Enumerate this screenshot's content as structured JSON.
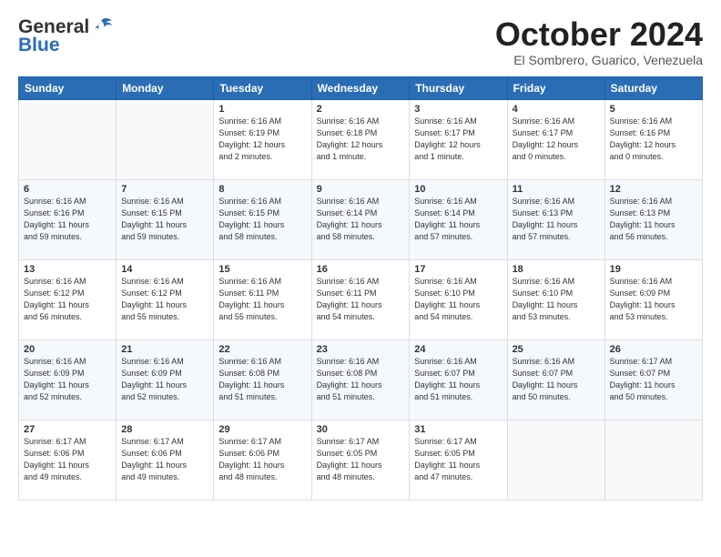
{
  "logo": {
    "line1": "General",
    "line2": "Blue"
  },
  "title": "October 2024",
  "subtitle": "El Sombrero, Guarico, Venezuela",
  "days_header": [
    "Sunday",
    "Monday",
    "Tuesday",
    "Wednesday",
    "Thursday",
    "Friday",
    "Saturday"
  ],
  "weeks": [
    [
      {
        "num": "",
        "info": ""
      },
      {
        "num": "",
        "info": ""
      },
      {
        "num": "1",
        "info": "Sunrise: 6:16 AM\nSunset: 6:19 PM\nDaylight: 12 hours\nand 2 minutes."
      },
      {
        "num": "2",
        "info": "Sunrise: 6:16 AM\nSunset: 6:18 PM\nDaylight: 12 hours\nand 1 minute."
      },
      {
        "num": "3",
        "info": "Sunrise: 6:16 AM\nSunset: 6:17 PM\nDaylight: 12 hours\nand 1 minute."
      },
      {
        "num": "4",
        "info": "Sunrise: 6:16 AM\nSunset: 6:17 PM\nDaylight: 12 hours\nand 0 minutes."
      },
      {
        "num": "5",
        "info": "Sunrise: 6:16 AM\nSunset: 6:16 PM\nDaylight: 12 hours\nand 0 minutes."
      }
    ],
    [
      {
        "num": "6",
        "info": "Sunrise: 6:16 AM\nSunset: 6:16 PM\nDaylight: 11 hours\nand 59 minutes."
      },
      {
        "num": "7",
        "info": "Sunrise: 6:16 AM\nSunset: 6:15 PM\nDaylight: 11 hours\nand 59 minutes."
      },
      {
        "num": "8",
        "info": "Sunrise: 6:16 AM\nSunset: 6:15 PM\nDaylight: 11 hours\nand 58 minutes."
      },
      {
        "num": "9",
        "info": "Sunrise: 6:16 AM\nSunset: 6:14 PM\nDaylight: 11 hours\nand 58 minutes."
      },
      {
        "num": "10",
        "info": "Sunrise: 6:16 AM\nSunset: 6:14 PM\nDaylight: 11 hours\nand 57 minutes."
      },
      {
        "num": "11",
        "info": "Sunrise: 6:16 AM\nSunset: 6:13 PM\nDaylight: 11 hours\nand 57 minutes."
      },
      {
        "num": "12",
        "info": "Sunrise: 6:16 AM\nSunset: 6:13 PM\nDaylight: 11 hours\nand 56 minutes."
      }
    ],
    [
      {
        "num": "13",
        "info": "Sunrise: 6:16 AM\nSunset: 6:12 PM\nDaylight: 11 hours\nand 56 minutes."
      },
      {
        "num": "14",
        "info": "Sunrise: 6:16 AM\nSunset: 6:12 PM\nDaylight: 11 hours\nand 55 minutes."
      },
      {
        "num": "15",
        "info": "Sunrise: 6:16 AM\nSunset: 6:11 PM\nDaylight: 11 hours\nand 55 minutes."
      },
      {
        "num": "16",
        "info": "Sunrise: 6:16 AM\nSunset: 6:11 PM\nDaylight: 11 hours\nand 54 minutes."
      },
      {
        "num": "17",
        "info": "Sunrise: 6:16 AM\nSunset: 6:10 PM\nDaylight: 11 hours\nand 54 minutes."
      },
      {
        "num": "18",
        "info": "Sunrise: 6:16 AM\nSunset: 6:10 PM\nDaylight: 11 hours\nand 53 minutes."
      },
      {
        "num": "19",
        "info": "Sunrise: 6:16 AM\nSunset: 6:09 PM\nDaylight: 11 hours\nand 53 minutes."
      }
    ],
    [
      {
        "num": "20",
        "info": "Sunrise: 6:16 AM\nSunset: 6:09 PM\nDaylight: 11 hours\nand 52 minutes."
      },
      {
        "num": "21",
        "info": "Sunrise: 6:16 AM\nSunset: 6:09 PM\nDaylight: 11 hours\nand 52 minutes."
      },
      {
        "num": "22",
        "info": "Sunrise: 6:16 AM\nSunset: 6:08 PM\nDaylight: 11 hours\nand 51 minutes."
      },
      {
        "num": "23",
        "info": "Sunrise: 6:16 AM\nSunset: 6:08 PM\nDaylight: 11 hours\nand 51 minutes."
      },
      {
        "num": "24",
        "info": "Sunrise: 6:16 AM\nSunset: 6:07 PM\nDaylight: 11 hours\nand 51 minutes."
      },
      {
        "num": "25",
        "info": "Sunrise: 6:16 AM\nSunset: 6:07 PM\nDaylight: 11 hours\nand 50 minutes."
      },
      {
        "num": "26",
        "info": "Sunrise: 6:17 AM\nSunset: 6:07 PM\nDaylight: 11 hours\nand 50 minutes."
      }
    ],
    [
      {
        "num": "27",
        "info": "Sunrise: 6:17 AM\nSunset: 6:06 PM\nDaylight: 11 hours\nand 49 minutes."
      },
      {
        "num": "28",
        "info": "Sunrise: 6:17 AM\nSunset: 6:06 PM\nDaylight: 11 hours\nand 49 minutes."
      },
      {
        "num": "29",
        "info": "Sunrise: 6:17 AM\nSunset: 6:06 PM\nDaylight: 11 hours\nand 48 minutes."
      },
      {
        "num": "30",
        "info": "Sunrise: 6:17 AM\nSunset: 6:05 PM\nDaylight: 11 hours\nand 48 minutes."
      },
      {
        "num": "31",
        "info": "Sunrise: 6:17 AM\nSunset: 6:05 PM\nDaylight: 11 hours\nand 47 minutes."
      },
      {
        "num": "",
        "info": ""
      },
      {
        "num": "",
        "info": ""
      }
    ]
  ]
}
